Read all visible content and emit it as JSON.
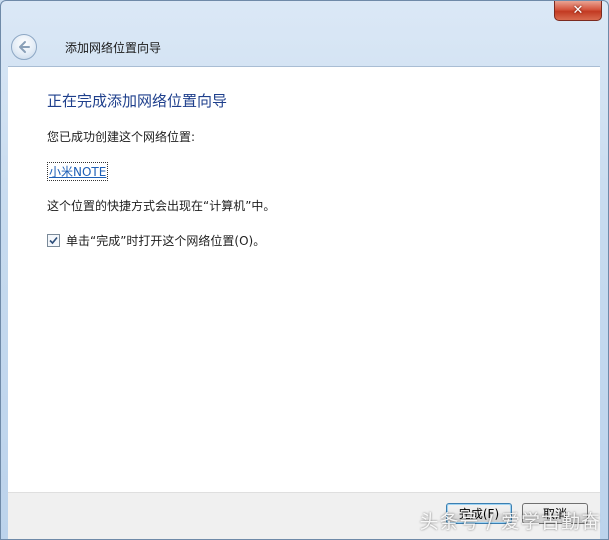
{
  "window": {
    "close_glyph": "✕"
  },
  "header": {
    "title": "添加网络位置向导",
    "back_icon": "back-arrow-icon"
  },
  "main": {
    "heading": "正在完成添加网络位置向导",
    "success_text": "您已成功创建这个网络位置:",
    "location_link": "小米NOTE",
    "shortcut_text": "这个位置的快捷方式会出现在“计算机”中。",
    "open_checkbox": {
      "label": "单击“完成”时打开这个网络位置(O)。",
      "checked": true
    }
  },
  "footer": {
    "finish_label": "完成(F)",
    "cancel_label": "取消"
  },
  "watermark": "头条号 / 爱学古勤奋",
  "colors": {
    "heading": "#1e3f8c",
    "link": "#1d5fb7",
    "close": "#c23a22"
  }
}
